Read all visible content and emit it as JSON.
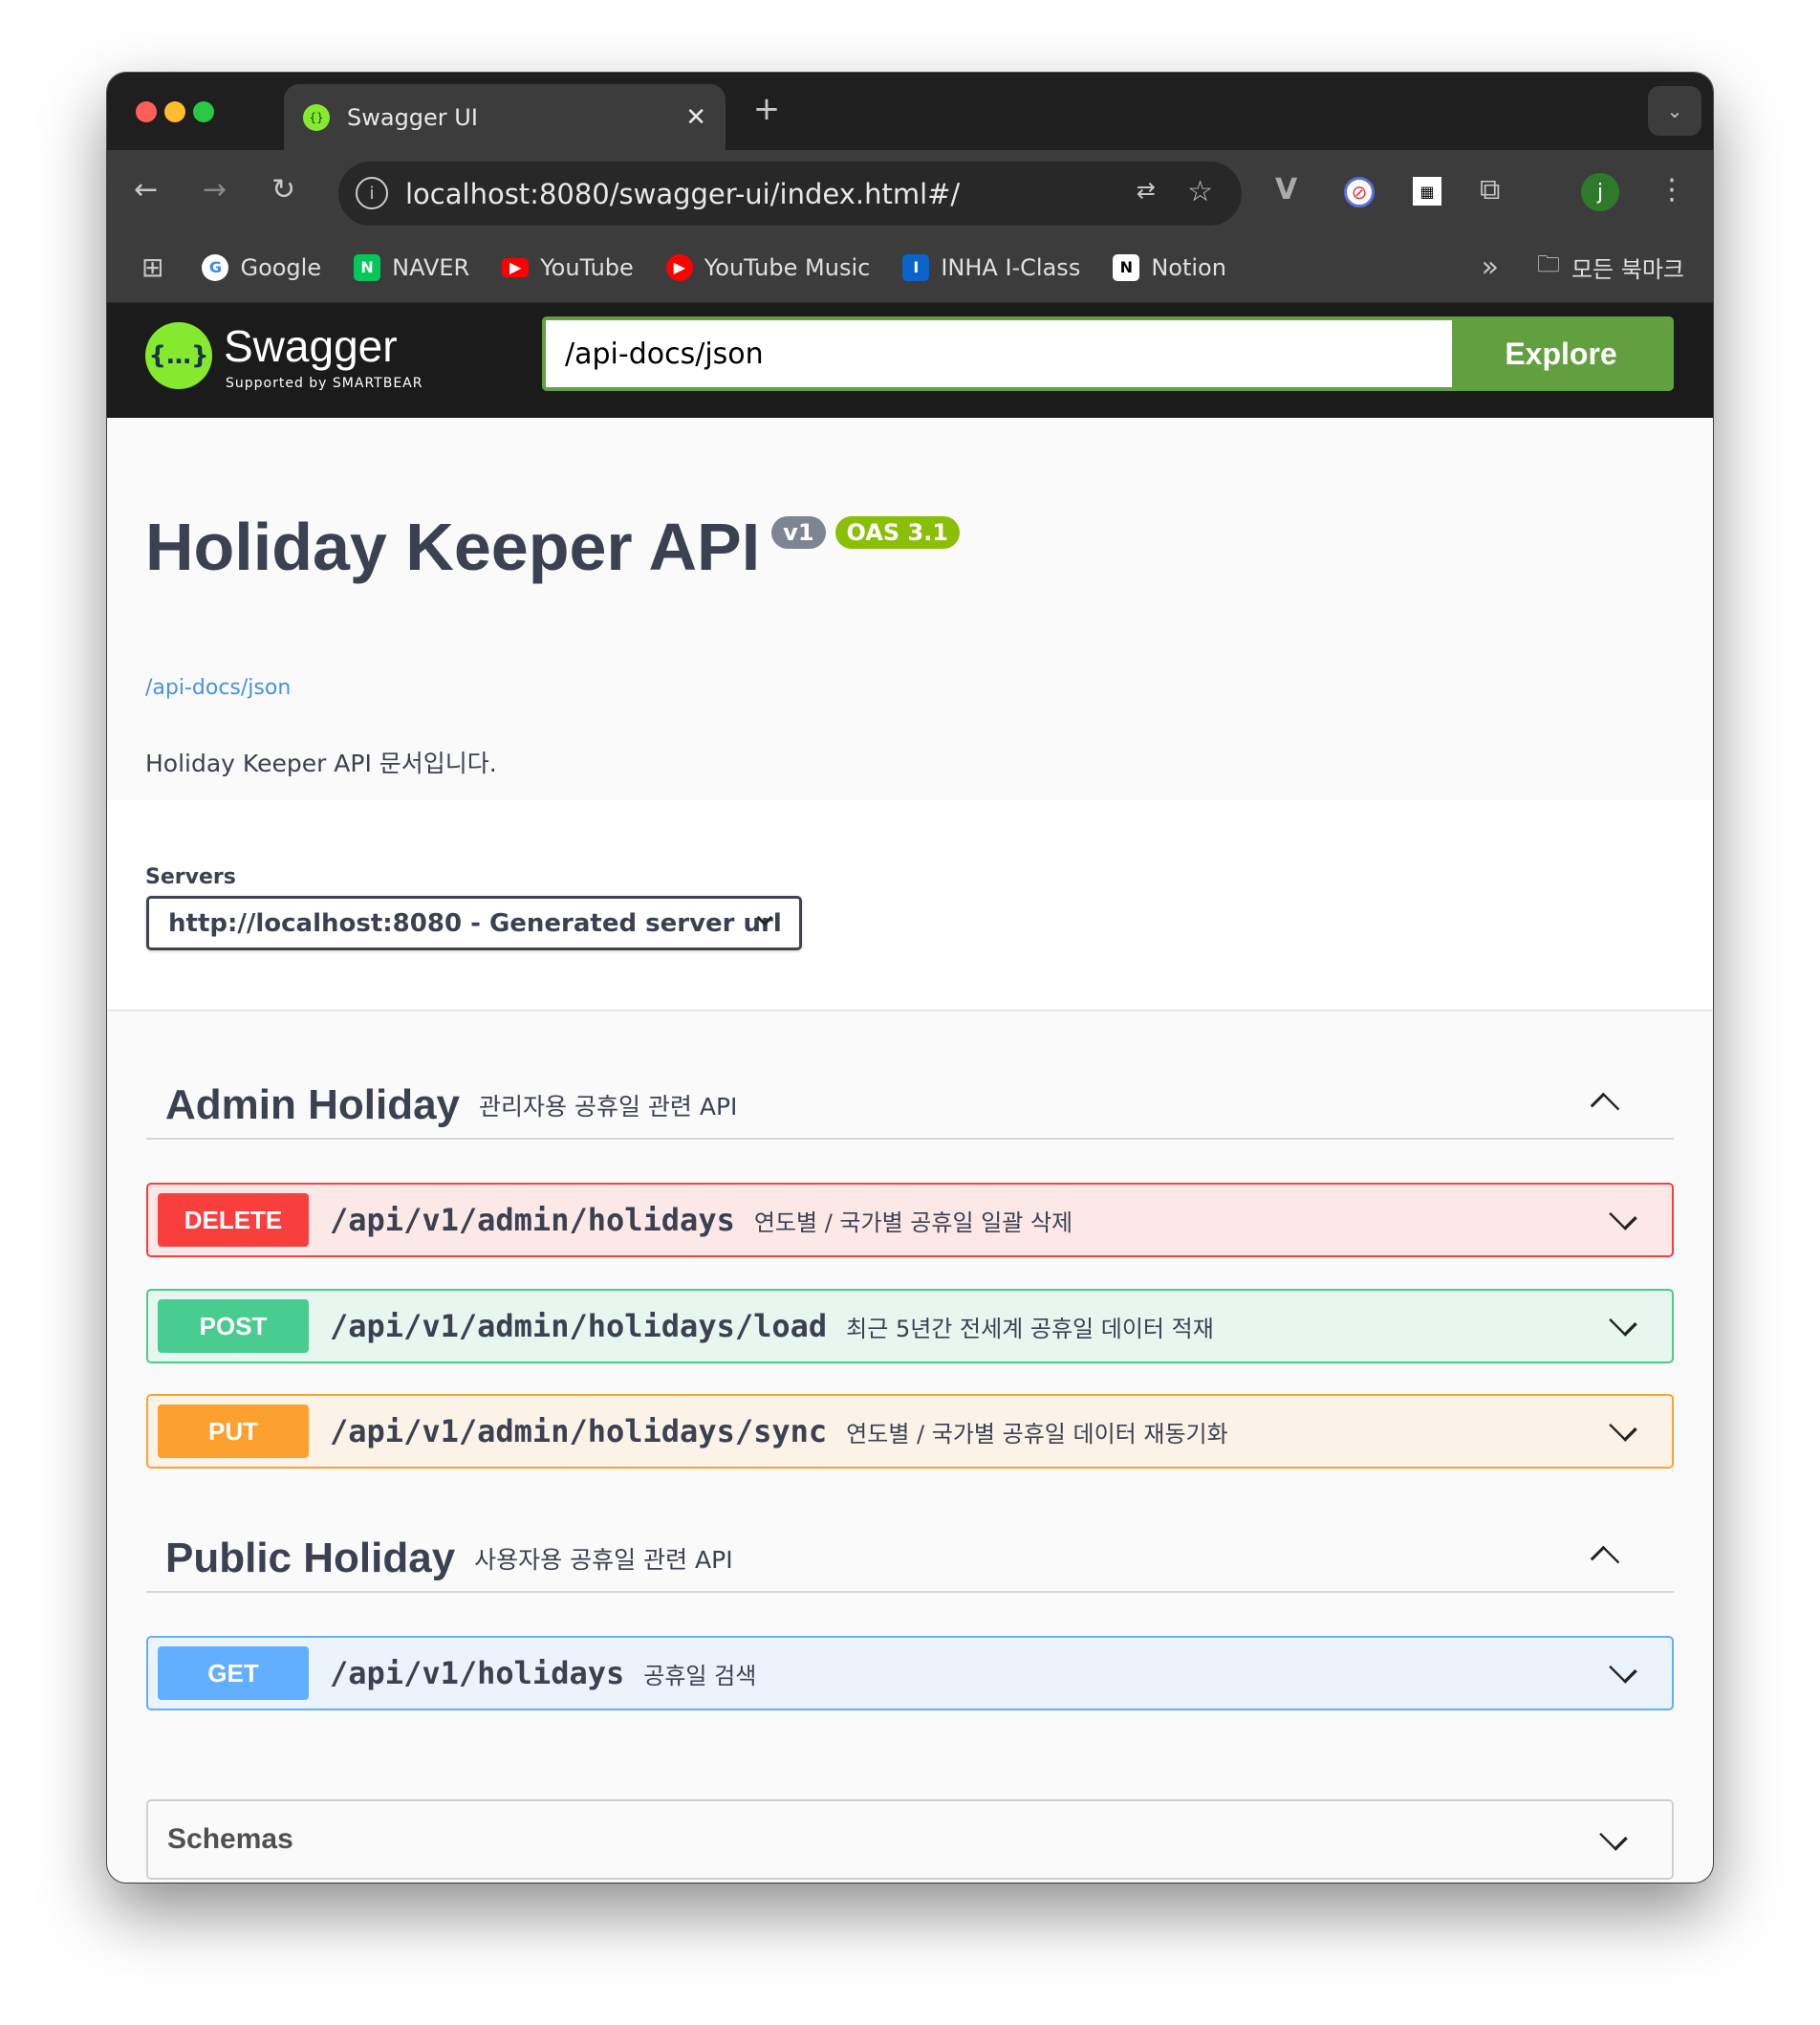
{
  "browser": {
    "tab_title": "Swagger UI",
    "url": "localhost:8080/swagger-ui/index.html#/",
    "profile_initial": "j",
    "bookmarks": [
      {
        "label": "Google",
        "icon": "google-icon",
        "color": "#ffffff"
      },
      {
        "label": "NAVER",
        "icon": "naver-icon",
        "color": "#03c75a"
      },
      {
        "label": "YouTube",
        "icon": "youtube-icon",
        "color": "#ff0000"
      },
      {
        "label": "YouTube Music",
        "icon": "youtube-music-icon",
        "color": "#ff0000"
      },
      {
        "label": "INHA I-Class",
        "icon": "inha-icon",
        "color": "#0a63c9"
      },
      {
        "label": "Notion",
        "icon": "notion-icon",
        "color": "#ffffff"
      }
    ],
    "all_bookmarks": "모든 북마크"
  },
  "swagger": {
    "logo_text": "Swagger",
    "logo_sub": "Supported by SMARTBEAR",
    "spec_url": "/api-docs/json",
    "explore_label": "Explore"
  },
  "info": {
    "title": "Holiday Keeper API",
    "version": "v1",
    "oas": "OAS 3.1",
    "link": "/api-docs/json",
    "description": "Holiday Keeper API 문서입니다."
  },
  "servers": {
    "label": "Servers",
    "selected": "http://localhost:8080 - Generated server url"
  },
  "tags": [
    {
      "name": "Admin Holiday",
      "description": "관리자용 공휴일 관련 API",
      "ops": [
        {
          "method": "DELETE",
          "path": "/api/v1/admin/holidays",
          "summary": "연도별 / 국가별 공휴일 일괄 삭제"
        },
        {
          "method": "POST",
          "path": "/api/v1/admin/holidays/load",
          "summary": "최근 5년간 전세계 공휴일 데이터 적재"
        },
        {
          "method": "PUT",
          "path": "/api/v1/admin/holidays/sync",
          "summary": "연도별 / 국가별 공휴일 데이터 재동기화"
        }
      ]
    },
    {
      "name": "Public Holiday",
      "description": "사용자용 공휴일 관련 API",
      "ops": [
        {
          "method": "GET",
          "path": "/api/v1/holidays",
          "summary": "공휴일 검색"
        }
      ]
    }
  ],
  "schemas_label": "Schemas",
  "colors": {
    "delete": "#f93e3e",
    "post": "#49cc90",
    "put": "#fca130",
    "get": "#61affe",
    "swagger_green": "#85ea2d",
    "explore": "#62a03f"
  }
}
